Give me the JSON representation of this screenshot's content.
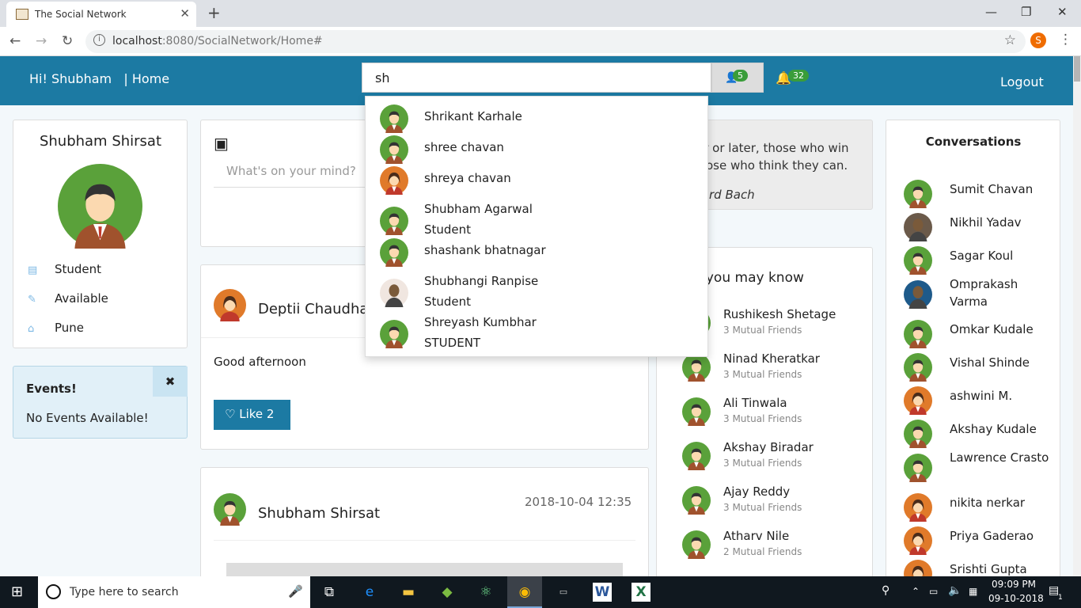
{
  "browser": {
    "tab_title": "The Social Network",
    "url_host": "localhost",
    "url_rest": ":8080/SocialNetwork/Home#",
    "profile_letter": "S"
  },
  "navbar": {
    "greeting": "Hi! Shubham",
    "sep": "|",
    "home": "Home",
    "search_value": "sh",
    "friend_count": "5",
    "notif_count": "32",
    "logout": "Logout"
  },
  "profile": {
    "name": "Shubham Shirsat",
    "role": "Student",
    "status": "Available",
    "city": "Pune"
  },
  "events": {
    "title": "Events!",
    "body": "No Events Available!",
    "close": "✖"
  },
  "composer": {
    "placeholder": "What's on your mind?"
  },
  "posts": [
    {
      "author": "Deptii Chaudha",
      "text": "Good afternoon",
      "like_label": "Like 2"
    },
    {
      "author": "Shubham Shirsat",
      "time": "2018-10-04 12:35"
    }
  ],
  "quote": {
    "line1": "er or later, those who win",
    "line2": "ose who think they can.",
    "author": "rd Bach"
  },
  "people_you_may_know": {
    "title": "e you may know",
    "items": [
      {
        "name": "Rushikesh Shetage",
        "mutual": "3 Mutual Friends"
      },
      {
        "name": "Ninad Kheratkar",
        "mutual": "3 Mutual Friends"
      },
      {
        "name": "Ali Tinwala",
        "mutual": "3 Mutual Friends"
      },
      {
        "name": "Akshay Biradar",
        "mutual": "3 Mutual Friends"
      },
      {
        "name": "Ajay Reddy",
        "mutual": "3 Mutual Friends"
      },
      {
        "name": "Atharv Nile",
        "mutual": "2 Mutual Friends"
      }
    ]
  },
  "conversations": {
    "title": "Conversations",
    "items": [
      {
        "name": "Sumit Chavan"
      },
      {
        "name": "Nikhil Yadav"
      },
      {
        "name": "Sagar Koul"
      },
      {
        "name": "Omprakash Varma"
      },
      {
        "name": "Omkar Kudale"
      },
      {
        "name": "Vishal Shinde"
      },
      {
        "name": "ashwini M."
      },
      {
        "name": "Akshay Kudale"
      },
      {
        "name": "Lawrence Crasto"
      },
      {
        "name": "nikita nerkar"
      },
      {
        "name": "Priya Gaderao"
      },
      {
        "name": "Srishti Gupta"
      }
    ]
  },
  "search_results": [
    {
      "name": "Shrikant Karhale",
      "sub": ""
    },
    {
      "name": "shree chavan",
      "sub": ""
    },
    {
      "name": "shreya chavan",
      "sub": ""
    },
    {
      "name": "Shubham Agarwal",
      "sub": "Student"
    },
    {
      "name": "shashank bhatnagar",
      "sub": ""
    },
    {
      "name": "Shubhangi Ranpise",
      "sub": "Student"
    },
    {
      "name": "Shreyash Kumbhar",
      "sub": "STUDENT"
    }
  ],
  "taskbar": {
    "search_placeholder": "Type here to search",
    "time": "09:09 PM",
    "date": "09-10-2018",
    "notif": "1"
  },
  "colors": {
    "primary": "#1c7aa3",
    "badge": "#3a9d3a",
    "avatar_green": "#5aa13a",
    "avatar_orange": "#e07a2a"
  }
}
